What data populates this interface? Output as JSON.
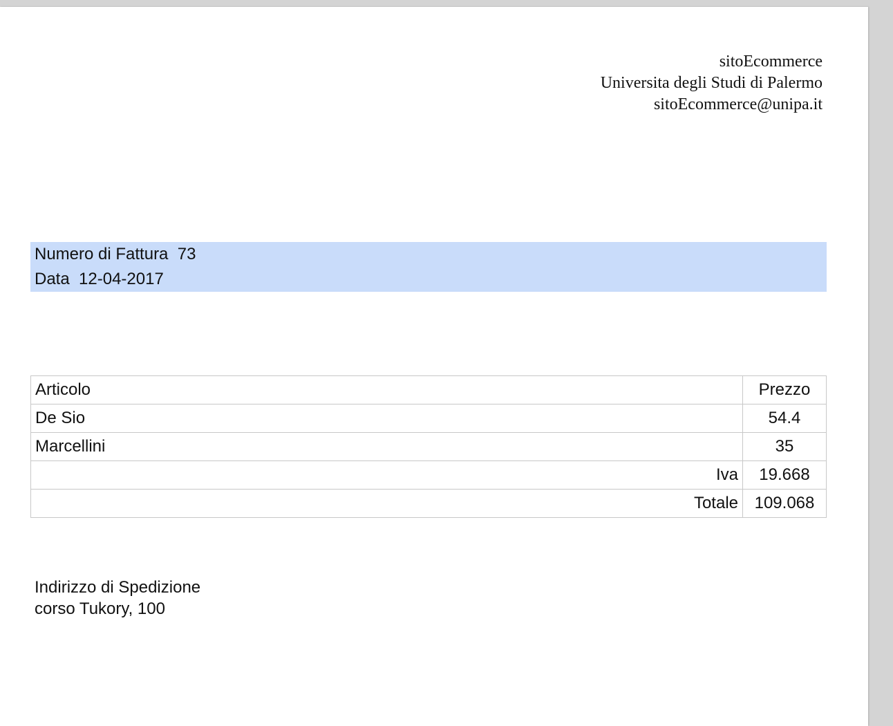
{
  "company": {
    "name": "sitoEcommerce",
    "university": "Universita degli Studi di Palermo",
    "email": "sitoEcommerce@unipa.it"
  },
  "invoice": {
    "number_label": "Numero di Fattura",
    "number": "73",
    "date_label": "Data",
    "date": "12-04-2017"
  },
  "table": {
    "headers": {
      "article": "Articolo",
      "price": "Prezzo"
    },
    "rows": [
      {
        "article": "De Sio",
        "price": "54.4"
      },
      {
        "article": "Marcellini",
        "price": "35"
      }
    ],
    "iva_label": "Iva",
    "iva": "19.668",
    "total_label": "Totale",
    "total": "109.068"
  },
  "shipping": {
    "label": "Indirizzo di Spedizione",
    "address": "corso Tukory, 100"
  },
  "colors": {
    "header_background": "#c9dcfa",
    "table_border": "#c8c8c8"
  }
}
